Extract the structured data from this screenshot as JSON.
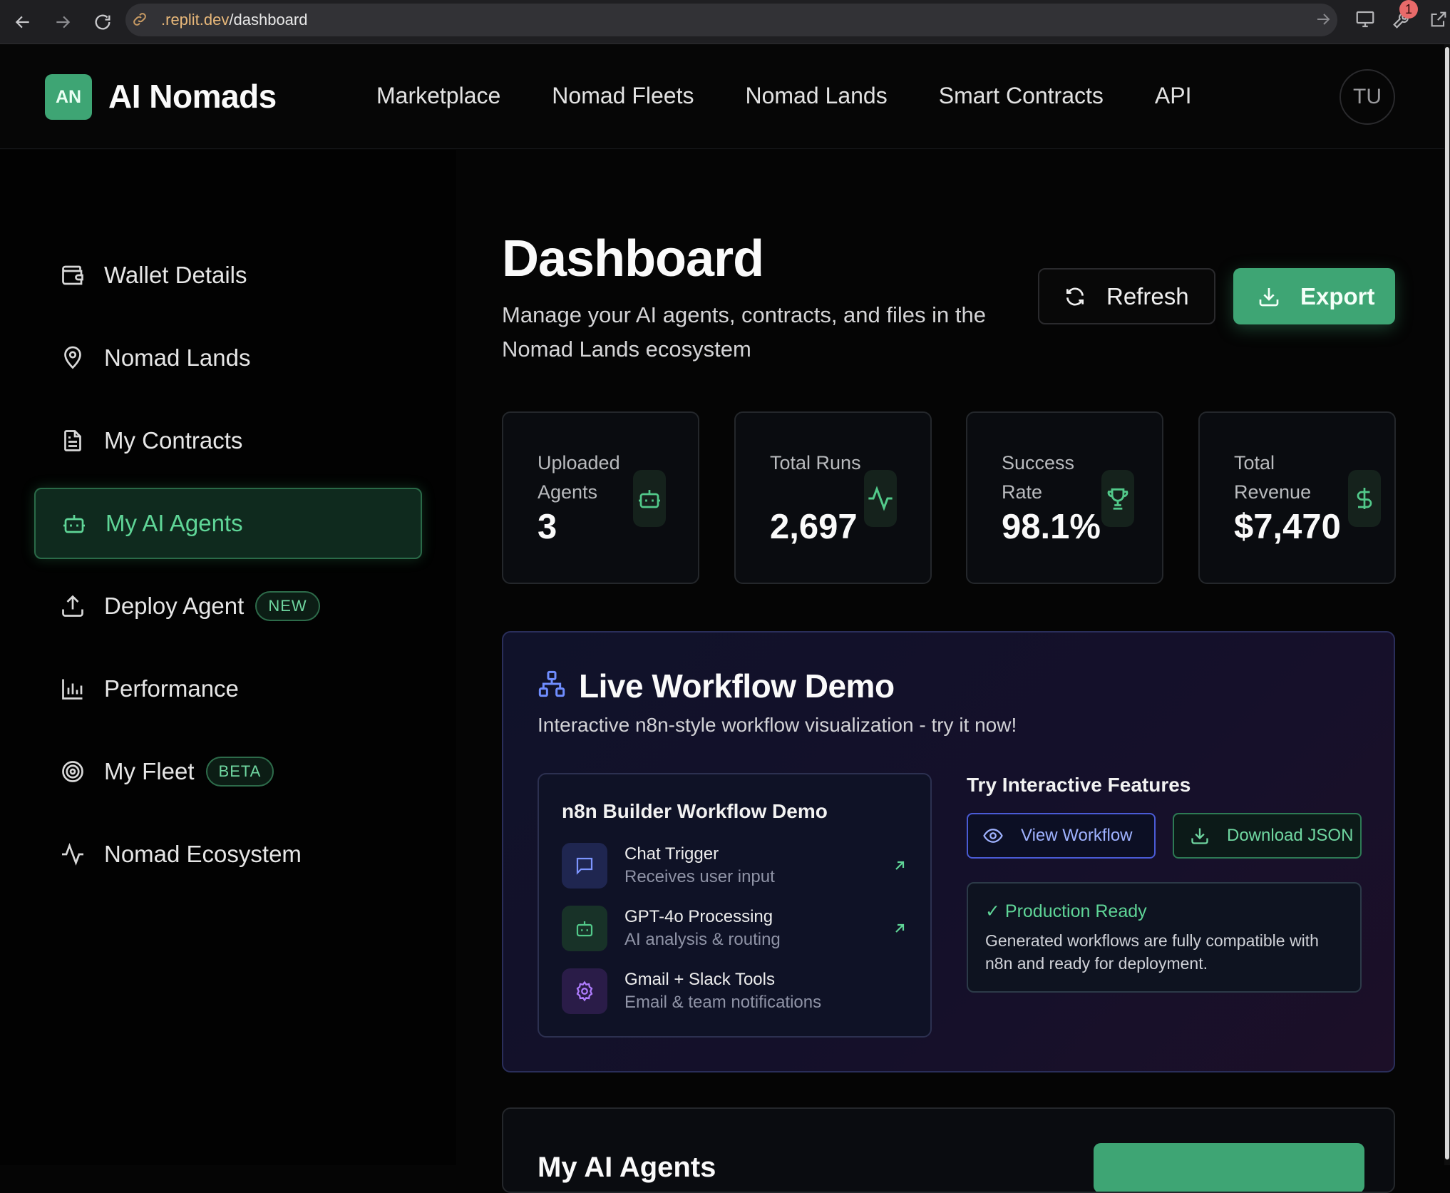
{
  "browser": {
    "url_prefix": ".replit.dev",
    "url_path": "/dashboard",
    "notification_count": "1"
  },
  "header": {
    "logo_badge": "AN",
    "app_name": "AI Nomads",
    "nav": [
      "Marketplace",
      "Nomad Fleets",
      "Nomad Lands",
      "Smart Contracts",
      "API"
    ],
    "avatar_initials": "TU"
  },
  "sidebar": {
    "items": [
      {
        "label": "Wallet Details",
        "icon": "wallet-icon"
      },
      {
        "label": "Nomad Lands",
        "icon": "map-pin-icon"
      },
      {
        "label": "My Contracts",
        "icon": "document-icon"
      },
      {
        "label": "My AI Agents",
        "icon": "bot-icon",
        "active": true
      },
      {
        "label": "Deploy Agent",
        "icon": "upload-icon",
        "badge": "NEW"
      },
      {
        "label": "Performance",
        "icon": "bar-chart-icon"
      },
      {
        "label": "My Fleet",
        "icon": "target-icon",
        "badge": "BETA"
      },
      {
        "label": "Nomad Ecosystem",
        "icon": "activity-icon"
      }
    ]
  },
  "main": {
    "title": "Dashboard",
    "subtitle": "Manage your AI agents, contracts, and files in the Nomad Lands ecosystem",
    "refresh_label": "Refresh",
    "export_label": "Export",
    "stats": [
      {
        "label": "Uploaded Agents",
        "value": "3",
        "icon": "bot-icon"
      },
      {
        "label": "Total Runs",
        "value": "2,697",
        "icon": "activity-icon"
      },
      {
        "label": "Success Rate",
        "value": "98.1%",
        "icon": "trophy-icon"
      },
      {
        "label": "Total Revenue",
        "value": "$7,470",
        "icon": "dollar-icon"
      }
    ]
  },
  "demo": {
    "title": "Live Workflow Demo",
    "subtitle": "Interactive n8n-style workflow visualization - try it now!",
    "workflow_title": "n8n Builder Workflow Demo",
    "steps": [
      {
        "name": "Chat Trigger",
        "desc": "Receives user input",
        "icon": "chat-icon"
      },
      {
        "name": "GPT-4o Processing",
        "desc": "AI analysis & routing",
        "icon": "bot-icon"
      },
      {
        "name": "Gmail + Slack Tools",
        "desc": "Email & team notifications",
        "icon": "gear-icon"
      }
    ],
    "try_title": "Try Interactive Features",
    "view_label": "View Workflow",
    "download_label": "Download JSON",
    "prod_title": "✓ Production Ready",
    "prod_text": "Generated workflows are fully compatible with n8n and ready for deployment."
  },
  "agents_section": {
    "title": "My AI Agents"
  },
  "colors": {
    "accent_green": "#3ea574",
    "accent_blue": "#4a5bd6",
    "background": "#050505"
  }
}
